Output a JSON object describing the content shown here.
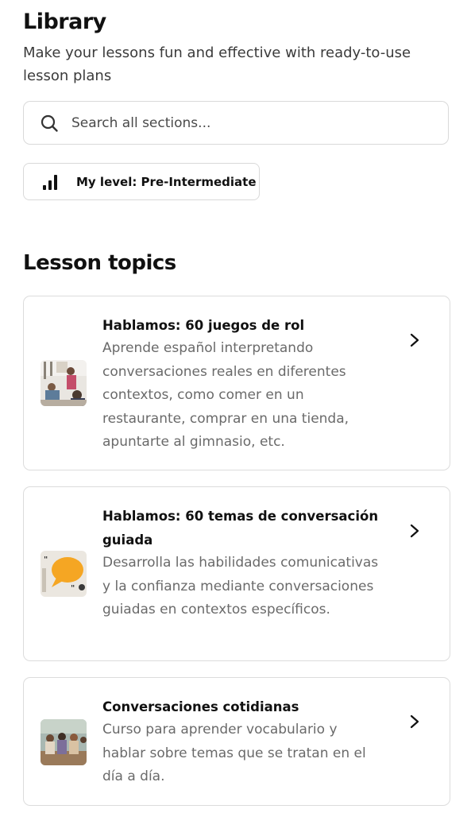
{
  "header": {
    "title": "Library",
    "subtitle": "Make your lessons fun and effective with ready-to-use lesson plans"
  },
  "search": {
    "placeholder": "Search all sections..."
  },
  "level_button": {
    "label": "My level: Pre-Intermediate",
    "icon": "signal-bars-icon"
  },
  "topics": {
    "heading": "Lesson topics",
    "cards": [
      {
        "title": "Hablamos: 60 juegos de rol",
        "description": "Aprende español interpretando conversaciones reales en diferentes contextos, como comer en un restaurante, comprar en una tienda, apuntarte al gimnasio, etc."
      },
      {
        "title": "Hablamos: 60 temas de conversación guiada",
        "description": "Desarrolla las habilidades comunicativas y la confianza mediante conversaciones guiadas en contextos específicos."
      },
      {
        "title": "Conversaciones cotidianas",
        "description": "Curso para aprender vocabulario y hablar sobre temas que se tratan en el día a día."
      }
    ]
  },
  "colors": {
    "text": "#111111",
    "muted": "#6a6a6a",
    "border": "#dcdcdc",
    "bubble": "#f5a623"
  }
}
